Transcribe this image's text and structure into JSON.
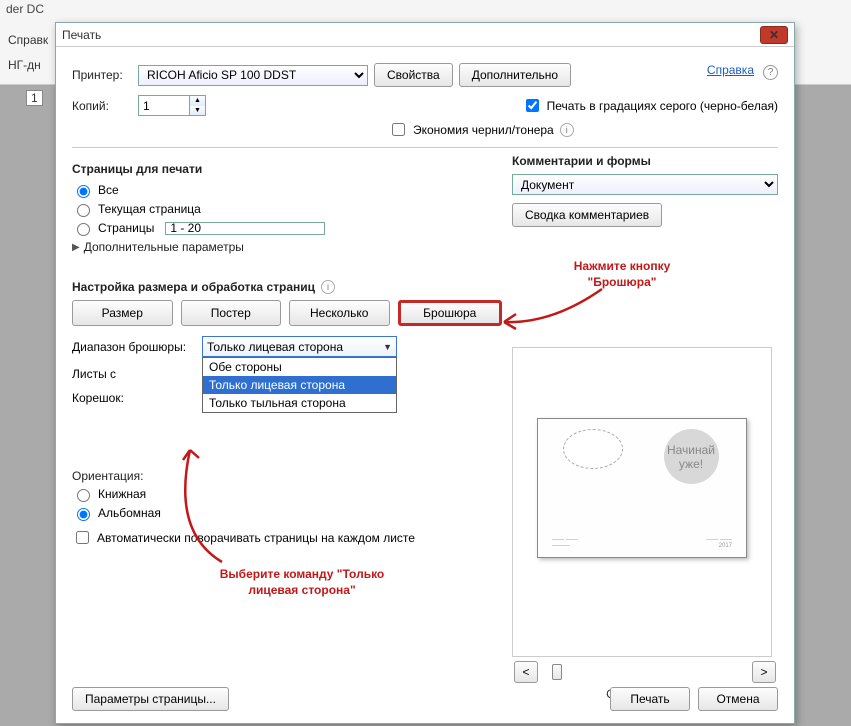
{
  "app": {
    "title_suffix": "der DC",
    "menu1": "Справк",
    "tab_text": "НГ-дн",
    "pagebox": "1"
  },
  "dialog": {
    "title": "Печать",
    "printer_label": "Принтер:",
    "printer_value": "RICOH Aficio SP 100 DDST",
    "btn_props": "Свойства",
    "btn_adv": "Дополнительно",
    "help": "Справка",
    "copies_label": "Копий:",
    "copies_value": "1",
    "chk_grayscale": "Печать в градациях серого (черно-белая)",
    "chk_save_ink": "Экономия чернил/тонера",
    "pages_group": "Страницы для печати",
    "radio_all": "Все",
    "radio_current": "Текущая страница",
    "radio_pages": "Страницы",
    "pages_range": "1 - 20",
    "more_params": "Дополнительные параметры",
    "size_group": "Настройка размера и обработка страниц",
    "tab_size": "Размер",
    "tab_poster": "Постер",
    "tab_multi": "Несколько",
    "tab_booklet": "Брошюра",
    "field_subset": "Диапазон брошюры:",
    "subset_value": "Только лицевая сторона",
    "subset_options": [
      "Обе стороны",
      "Только лицевая сторона",
      "Только тыльная сторона"
    ],
    "field_sheets": "Листы с",
    "field_binding": "Корешок:",
    "orient_label": "Ориентация:",
    "orient_portrait": "Книжная",
    "orient_landscape": "Альбомная",
    "chk_autorotate": "Автоматически поворачивать страницы на каждом листе",
    "comments_group": "Комментарии и формы",
    "comments_value": "Документ",
    "btn_summarize": "Сводка комментариев",
    "annot_booklet": "Нажмите кнопку\n\"Брошюра\"",
    "annot_select": "Выберите команду\n\"Только лицевая сторона\"",
    "page_of": "Стр. 1 из 5 (1)",
    "btn_page_setup": "Параметры страницы...",
    "btn_print": "Печать",
    "btn_cancel": "Отмена"
  }
}
